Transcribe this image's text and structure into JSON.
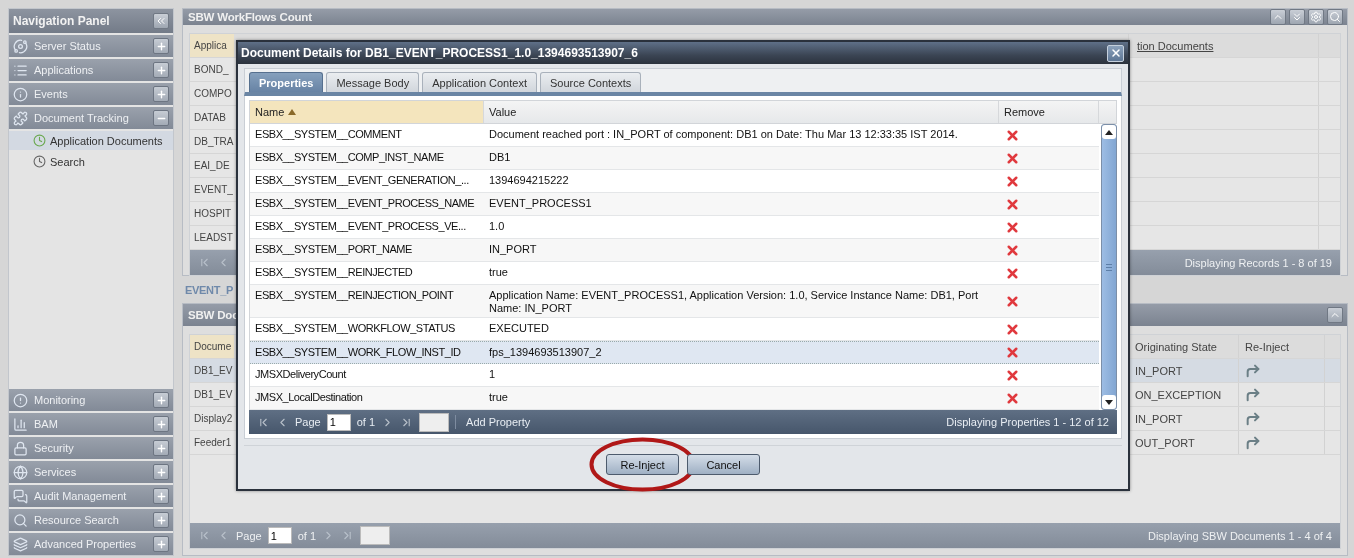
{
  "nav": {
    "title": "Navigation Panel",
    "items": [
      {
        "label": "Server Status",
        "expanded": false
      },
      {
        "label": "Applications",
        "expanded": false
      },
      {
        "label": "Events",
        "expanded": false
      },
      {
        "label": "Document Tracking",
        "expanded": true,
        "children": [
          {
            "label": "Application Documents",
            "selected": true
          },
          {
            "label": "Search",
            "selected": false
          }
        ]
      }
    ],
    "bottom_items": [
      {
        "label": "Monitoring",
        "expanded": false
      },
      {
        "label": "BAM",
        "expanded": false
      },
      {
        "label": "Security",
        "expanded": false
      },
      {
        "label": "Services",
        "expanded": false
      },
      {
        "label": "Audit Management",
        "expanded": false
      },
      {
        "label": "Resource Search",
        "expanded": false
      },
      {
        "label": "Advanced Properties",
        "expanded": false
      }
    ]
  },
  "workflows_panel": {
    "title": "SBW WorkFlows Count",
    "column_1": "Applica",
    "last_column": "tion Documents",
    "rows": [
      "BOND_",
      "COMPO",
      "DATAB",
      "DB_TRA",
      "EAI_DE",
      "EVENT_",
      "HOSPIT",
      "LEADST"
    ],
    "pager_status": "Displaying Records 1 - 8 of 19"
  },
  "link": "EVENT_P",
  "documents_panel": {
    "title": "SBW Doc",
    "columns": [
      "Docume",
      "Originating State",
      "Re-Inject"
    ],
    "rows": [
      {
        "column_1": "DB1_EV",
        "originating_state": "IN_PORT",
        "selected": true
      },
      {
        "column_1": "DB1_EV",
        "originating_state": "ON_EXCEPTION",
        "selected": false
      },
      {
        "column_1": "Display2",
        "originating_state": "IN_PORT",
        "selected": false
      },
      {
        "column_1": "Feeder1",
        "originating_state": "OUT_PORT",
        "selected": false
      }
    ],
    "pager": {
      "page_label": "Page",
      "page_value": "1",
      "of": "of 1",
      "status": "Displaying SBW Documents 1 - 4 of 4"
    }
  },
  "dialog": {
    "title": "Document Details for DB1_EVENT_PROCESS1_1.0_1394693513907_6",
    "tabs": [
      {
        "label": "Properties",
        "selected": true
      },
      {
        "label": "Message Body",
        "selected": false
      },
      {
        "label": "Application Context",
        "selected": false
      },
      {
        "label": "Source Contexts",
        "selected": false
      }
    ],
    "columns": [
      {
        "label": "Name",
        "sorted": true
      },
      {
        "label": "Value",
        "sorted": false
      },
      {
        "label": "Remove",
        "sorted": false
      }
    ],
    "rows": [
      {
        "name": "ESBX__SYSTEM__COMMENT",
        "value": "Document reached port : IN_PORT of component: DB1 on Date: Thu Mar 13 12:33:35 IST 2014.",
        "selected": false
      },
      {
        "name": "ESBX__SYSTEM__COMP_INST_NAME",
        "value": "DB1",
        "selected": false
      },
      {
        "name": "ESBX__SYSTEM__EVENT_GENERATION_...",
        "value": "1394694215222",
        "selected": false
      },
      {
        "name": "ESBX__SYSTEM__EVENT_PROCESS_NAME",
        "value": "EVENT_PROCESS1",
        "selected": false
      },
      {
        "name": "ESBX__SYSTEM__EVENT_PROCESS_VE...",
        "value": "1.0",
        "selected": false
      },
      {
        "name": "ESBX__SYSTEM__PORT_NAME",
        "value": "IN_PORT",
        "selected": false
      },
      {
        "name": "ESBX__SYSTEM__REINJECTED",
        "value": "true",
        "selected": false
      },
      {
        "name": "ESBX__SYSTEM__REINJECTION_POINT",
        "value": "Application Name: EVENT_PROCESS1, Application Version: 1.0, Service Instance Name: DB1, Port Name: IN_PORT",
        "selected": false
      },
      {
        "name": "ESBX__SYSTEM__WORKFLOW_STATUS",
        "value": "EXECUTED",
        "selected": false
      },
      {
        "name": "ESBX__SYSTEM__WORK_FLOW_INST_ID",
        "value": "fps_1394693513907_2",
        "selected": true
      },
      {
        "name": "JMSXDeliveryCount",
        "value": "1",
        "selected": false
      },
      {
        "name": "JMSX_LocalDestination",
        "value": "true",
        "selected": false
      }
    ],
    "pager": {
      "page_label": "Page",
      "page_value": "1",
      "of": "of 1",
      "add_button": "Add Property",
      "status": "Displaying Properties 1 - 12 of 12"
    },
    "buttons": [
      {
        "label": "Re-Inject",
        "highlighted": true
      },
      {
        "label": "Cancel",
        "highlighted": false
      }
    ]
  }
}
